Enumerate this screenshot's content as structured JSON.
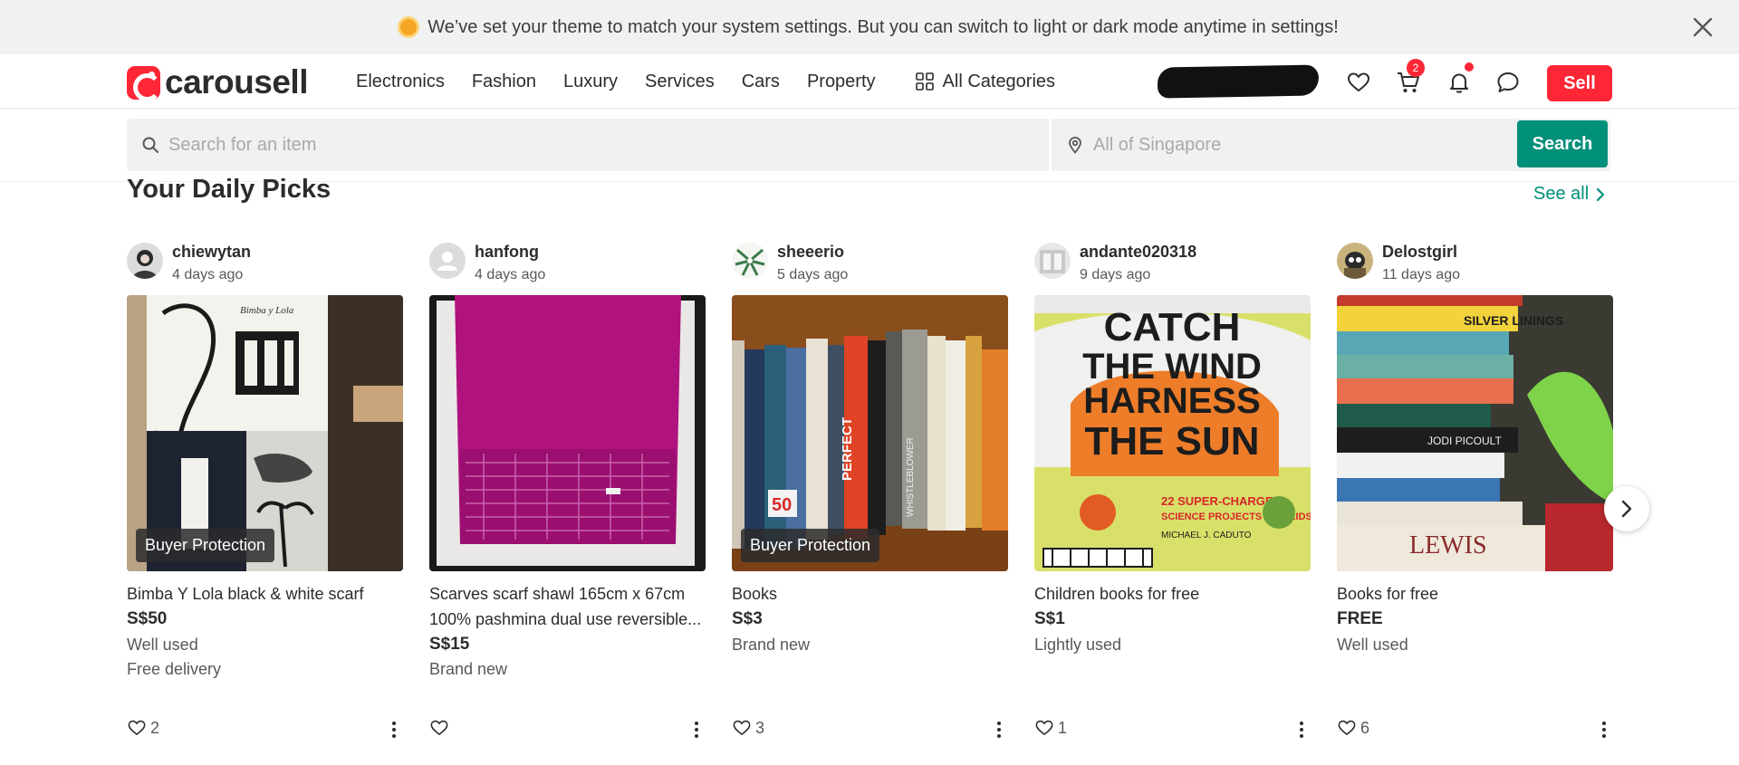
{
  "banner": {
    "message": "We’ve set your theme to match your system settings. But you can switch to light or dark mode anytime in settings!",
    "icon": "sun-icon",
    "close_icon": "close-icon"
  },
  "header": {
    "logo_text": "carousell",
    "nav_items": [
      "Electronics",
      "Fashion",
      "Luxury",
      "Services",
      "Cars",
      "Property"
    ],
    "all_categories_label": "All Categories",
    "cart_count": "2",
    "sell_label": "Sell",
    "brand_color": "#ff2636"
  },
  "search": {
    "placeholder": "Search for an item",
    "location_placeholder": "All of Singapore",
    "button_label": "Search",
    "button_color": "#008f79"
  },
  "section": {
    "title": "Your Daily Picks",
    "see_all_label": "See all"
  },
  "listings": [
    {
      "seller": "chiewytan",
      "ago": "4 days ago",
      "badge": "Buyer Protection",
      "title": "Bimba Y Lola black & white scarf",
      "price": "S$50",
      "condition": "Well used",
      "extra": "Free delivery",
      "likes": "2"
    },
    {
      "seller": "hanfong",
      "ago": "4 days ago",
      "badge": "",
      "title": "Scarves scarf shawl 165cm x 67cm 100% pashmina dual use reversible...",
      "price": "S$15",
      "condition": "Brand new",
      "extra": "",
      "likes": ""
    },
    {
      "seller": "sheeerio",
      "ago": "5 days ago",
      "badge": "Buyer Protection",
      "title": "Books",
      "price": "S$3",
      "condition": "Brand new",
      "extra": "",
      "likes": "3"
    },
    {
      "seller": "andante020318",
      "ago": "9 days ago",
      "badge": "",
      "title": "Children books for free",
      "price": "S$1",
      "condition": "Lightly used",
      "extra": "",
      "likes": "1"
    },
    {
      "seller": "Delostgirl",
      "ago": "11 days ago",
      "badge": "",
      "title": "Books for free",
      "price": "FREE",
      "condition": "Well used",
      "extra": "",
      "likes": "6"
    }
  ],
  "photo_text": {
    "book_cover": [
      "CATCH",
      "THE WIND",
      "HARNESS",
      "THE SUN",
      "22 SUPER-CHARGED",
      "SCIENCE PROJECTS FOR KIDS",
      "MICHAEL J. CADUTO"
    ],
    "scarf_print": "Bimba y Lola",
    "spine_perfect": "PERFECT",
    "spine_whistleblower": "WHISTLEBLOWER",
    "spine_50": "50",
    "spine_lewis": "LEWIS",
    "spine_silver_linings": "SILVER LININGS",
    "spine_jodi": "JODI PICOULT"
  }
}
